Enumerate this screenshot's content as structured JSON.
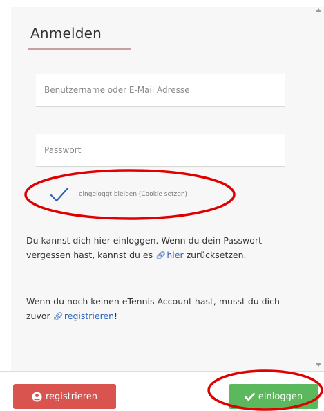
{
  "form": {
    "title": "Anmelden",
    "username_placeholder": "Benutzername oder E-Mail Adresse",
    "password_placeholder": "Passwort",
    "remember_label": "eingeloggt bleiben (Cookie setzen)"
  },
  "info": {
    "para1_text": "Du kannst dich hier einloggen. Wenn du dein Passwort vergessen hast, kannst du es",
    "para1_link": "hier",
    "para1_end": "zurücksetzen.",
    "para2_text": "Wenn du noch keinen eTennis Account hast, musst du dich zuvor",
    "para2_link": "registrieren",
    "para2_end": "!"
  },
  "footer": {
    "register_label": "registrieren",
    "login_label": "einloggen"
  },
  "icons": {
    "link": "link-icon",
    "user_circle": "user-circle-icon",
    "check": "check-icon"
  },
  "colors": {
    "register_button": "#d9534f",
    "login_button": "#5cb85c",
    "link": "#2a62b8",
    "annotation": "#e00000",
    "title_underline": "#c9a0a0"
  },
  "remember_checked": true
}
